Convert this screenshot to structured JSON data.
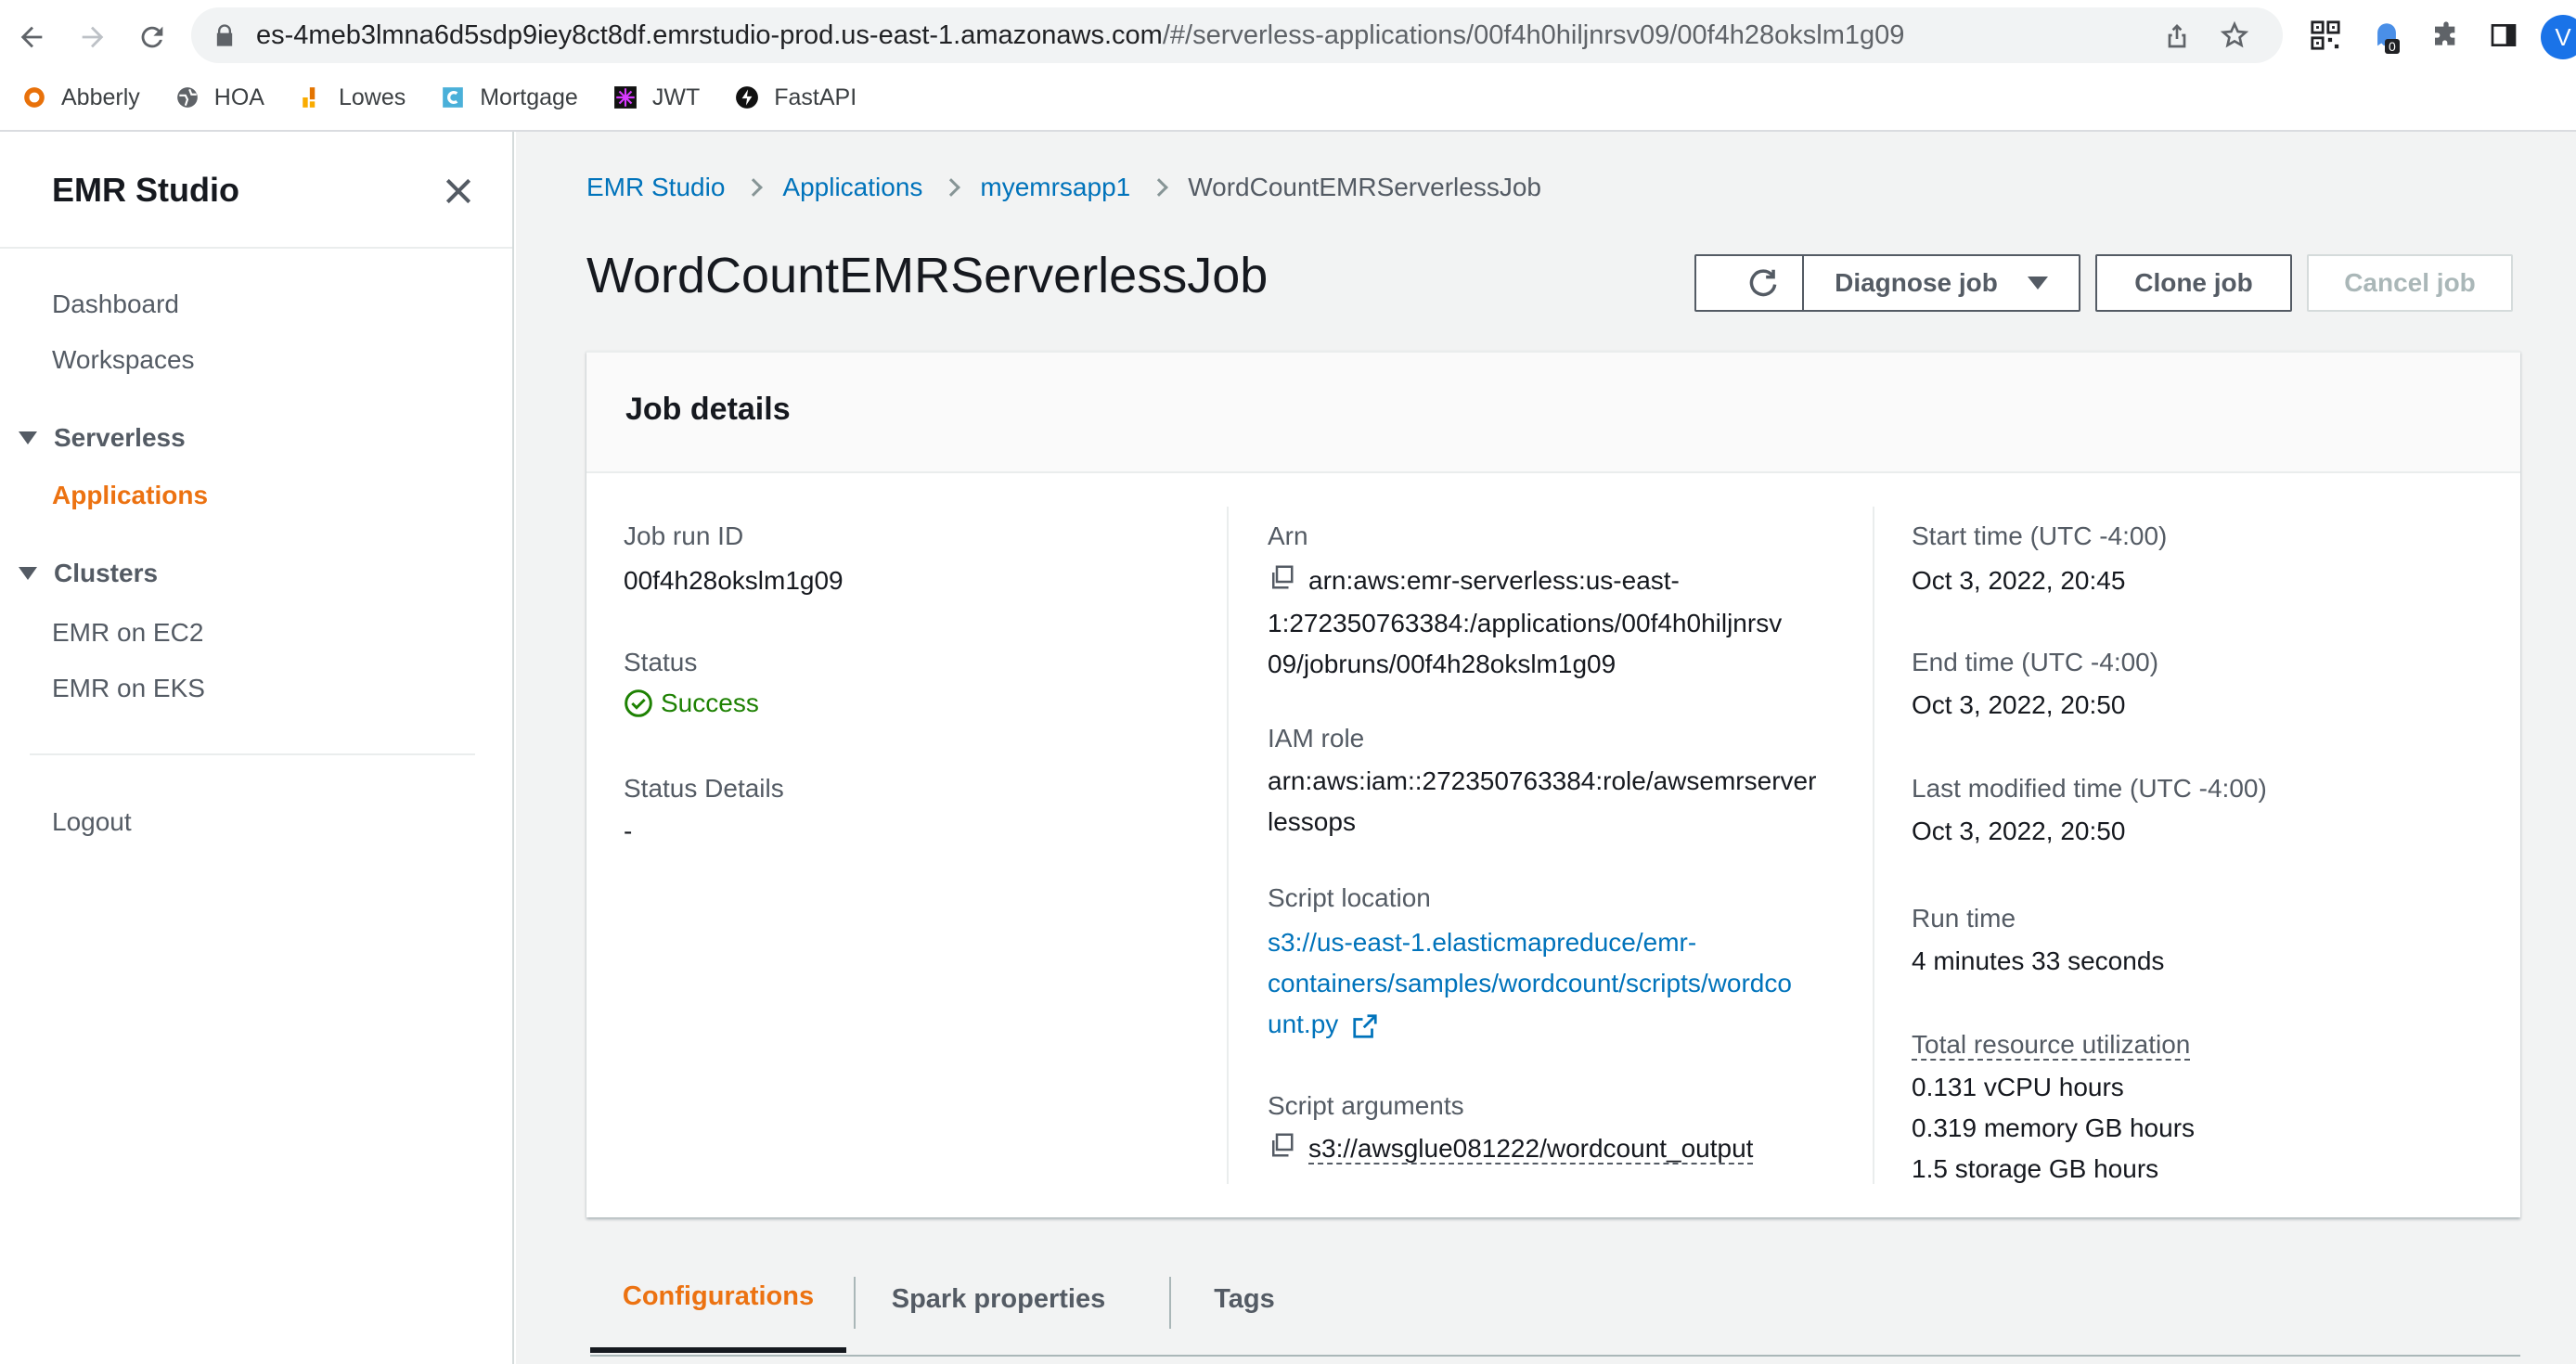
{
  "browser": {
    "url_host": "es-4meb3lmna6d5sdp9iey8ct8df.emrstudio-prod.us-east-1.amazonaws.com",
    "url_path": "/#/serverless-applications/00f4h0hiljnrsv09/00f4h28okslm1g09",
    "bookmarks": [
      "Abberly",
      "HOA",
      "Lowes",
      "Mortgage",
      "JWT",
      "FastAPI"
    ],
    "ext_badge": "0",
    "profile_initial": "V"
  },
  "sidebar": {
    "title": "EMR Studio",
    "items": [
      "Dashboard",
      "Workspaces"
    ],
    "serverless_label": "Serverless",
    "serverless_items": [
      "Applications"
    ],
    "clusters_label": "Clusters",
    "clusters_items": [
      "EMR on EC2",
      "EMR on EKS"
    ],
    "logout": "Logout"
  },
  "breadcrumb": [
    "EMR Studio",
    "Applications",
    "myemrsapp1",
    "WordCountEMRServerlessJob"
  ],
  "page_title": "WordCountEMRServerlessJob",
  "actions": {
    "diagnose": "Diagnose job",
    "clone": "Clone job",
    "cancel": "Cancel job"
  },
  "job_details": {
    "title": "Job details",
    "job_run_id_label": "Job run ID",
    "job_run_id": "00f4h28okslm1g09",
    "status_label": "Status",
    "status": "Success",
    "status_details_label": "Status Details",
    "status_details": "-",
    "arn_label": "Arn",
    "arn_lines": [
      "arn:aws:emr-serverless:us-east-",
      "1:272350763384:/applications/00f4h0hiljnrsv",
      "09/jobruns/00f4h28okslm1g09"
    ],
    "iam_role_label": "IAM role",
    "iam_role_lines": [
      "arn:aws:iam::272350763384:role/awsemrserver",
      "lessops"
    ],
    "script_location_label": "Script location",
    "script_location_lines": [
      "s3://us-east-1.elasticmapreduce/emr-",
      "containers/samples/wordcount/scripts/wordco",
      "unt.py"
    ],
    "script_arguments_label": "Script arguments",
    "script_arguments": "s3://awsglue081222/wordcount_output",
    "start_time_label": "Start time (UTC -4:00)",
    "start_time": "Oct 3, 2022, 20:45",
    "end_time_label": "End time (UTC -4:00)",
    "end_time": "Oct 3, 2022, 20:50",
    "last_modified_label": "Last modified time (UTC -4:00)",
    "last_modified": "Oct 3, 2022, 20:50",
    "run_time_label": "Run time",
    "run_time": "4 minutes 33 seconds",
    "total_resource_label": "Total resource utilization",
    "vcpu": "0.131 vCPU hours",
    "memory": "0.319 memory GB hours",
    "storage": "1.5 storage GB hours"
  },
  "tabs": [
    "Configurations",
    "Spark properties",
    "Tags"
  ],
  "colors": {
    "accent_orange": "#ec7211",
    "link_blue": "#0073bb",
    "success_green": "#1d8102"
  }
}
